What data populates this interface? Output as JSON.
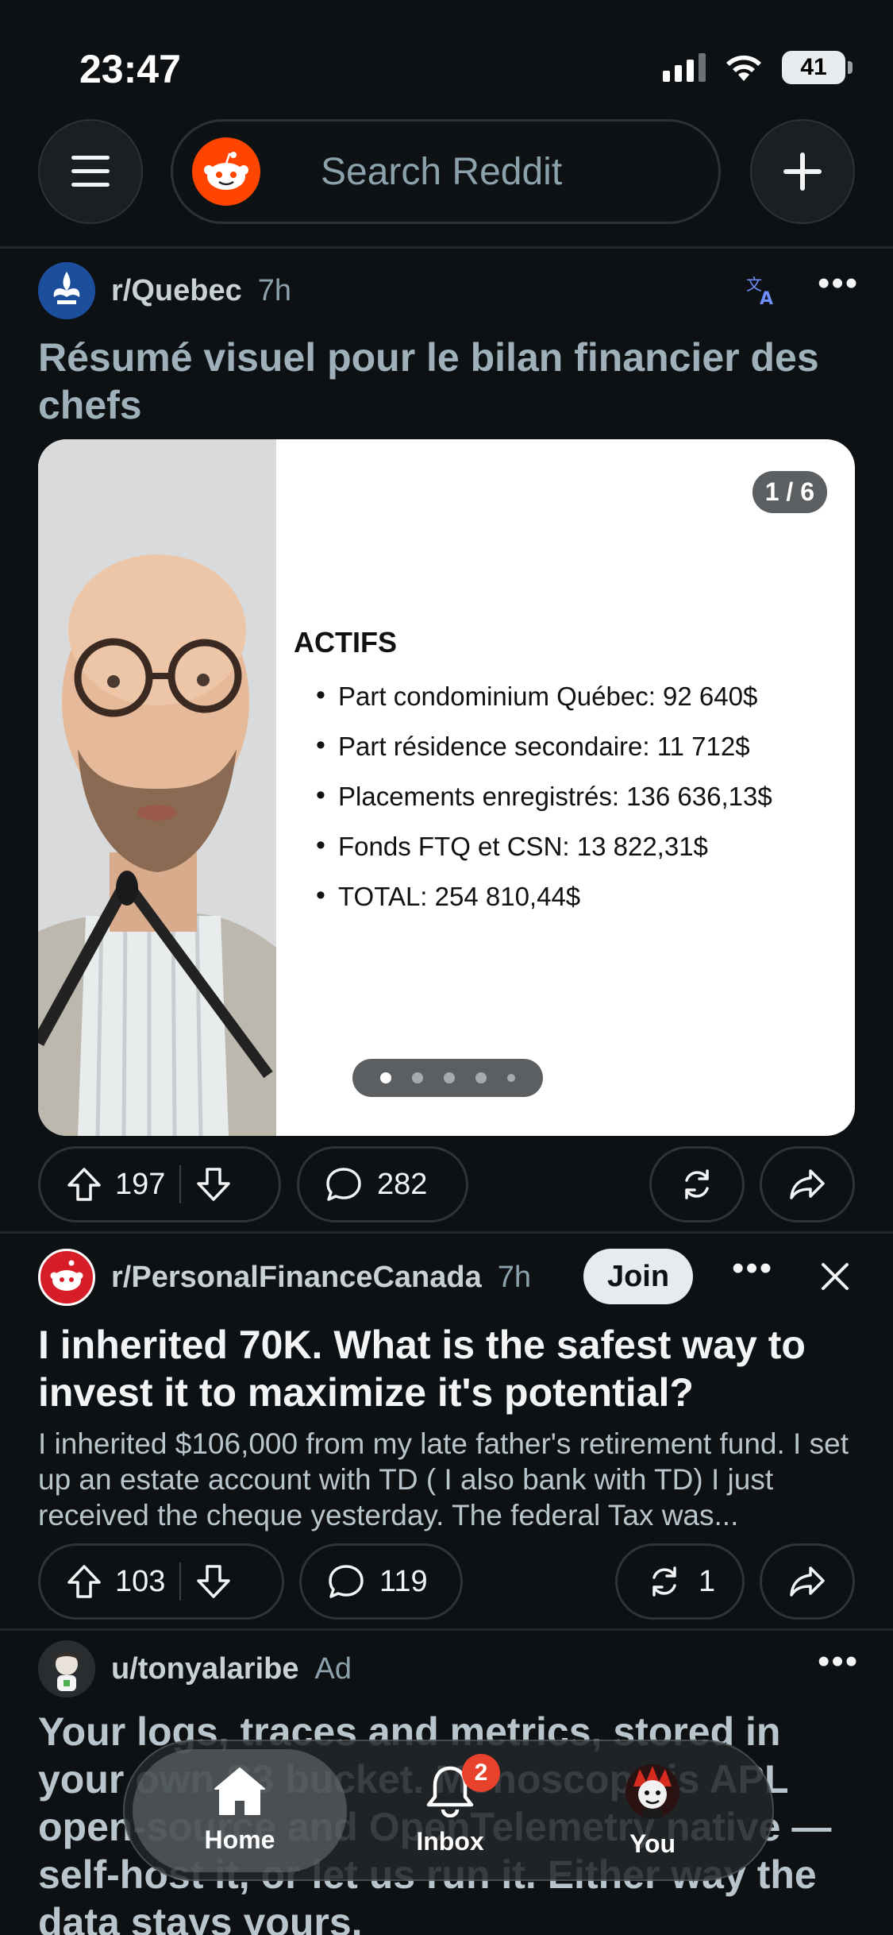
{
  "status_bar": {
    "time": "23:47",
    "battery": "41"
  },
  "top_nav": {
    "search_placeholder": "Search Reddit"
  },
  "post1": {
    "subreddit": "r/Quebec",
    "age": "7h",
    "title": "Résumé visuel pour le bilan financier des chefs",
    "slide_counter": "1 / 6",
    "slide_heading": "ACTIFS",
    "slide_items": [
      "Part condominium Québec: 92 640$",
      "Part résidence secondaire: 11 712$",
      "Placements enregistrés: 136 636,13$",
      "Fonds FTQ et CSN: 13 822,31$",
      "TOTAL: 254 810,44$"
    ],
    "upvotes": "197",
    "comments": "282"
  },
  "post2": {
    "subreddit": "r/PersonalFinanceCanada",
    "age": "7h",
    "join_label": "Join",
    "title": "I inherited 70K. What is the safest way to invest it to maximize it's potential?",
    "body": "I inherited $106,000 from my late father's retirement fund. I set up an estate account with TD ( I also bank with TD) I just received the cheque yesterday. The federal Tax was...",
    "upvotes": "103",
    "comments": "119",
    "crossposts": "1"
  },
  "post3": {
    "author": "u/tonyalaribe",
    "ad_label": "Ad",
    "title": "Your logs, traces and metrics, stored in your own S3 bucket. Monoscope is APL open-source and OpenTelemetry native — self-host it, or let us run it. Either way the data stays yours."
  },
  "tab_bar": {
    "home": "Home",
    "inbox": "Inbox",
    "inbox_badge": "2",
    "you": "You"
  },
  "colors": {
    "accent": "#ff4500",
    "background": "#0e1113",
    "badge": "#e8412c"
  }
}
